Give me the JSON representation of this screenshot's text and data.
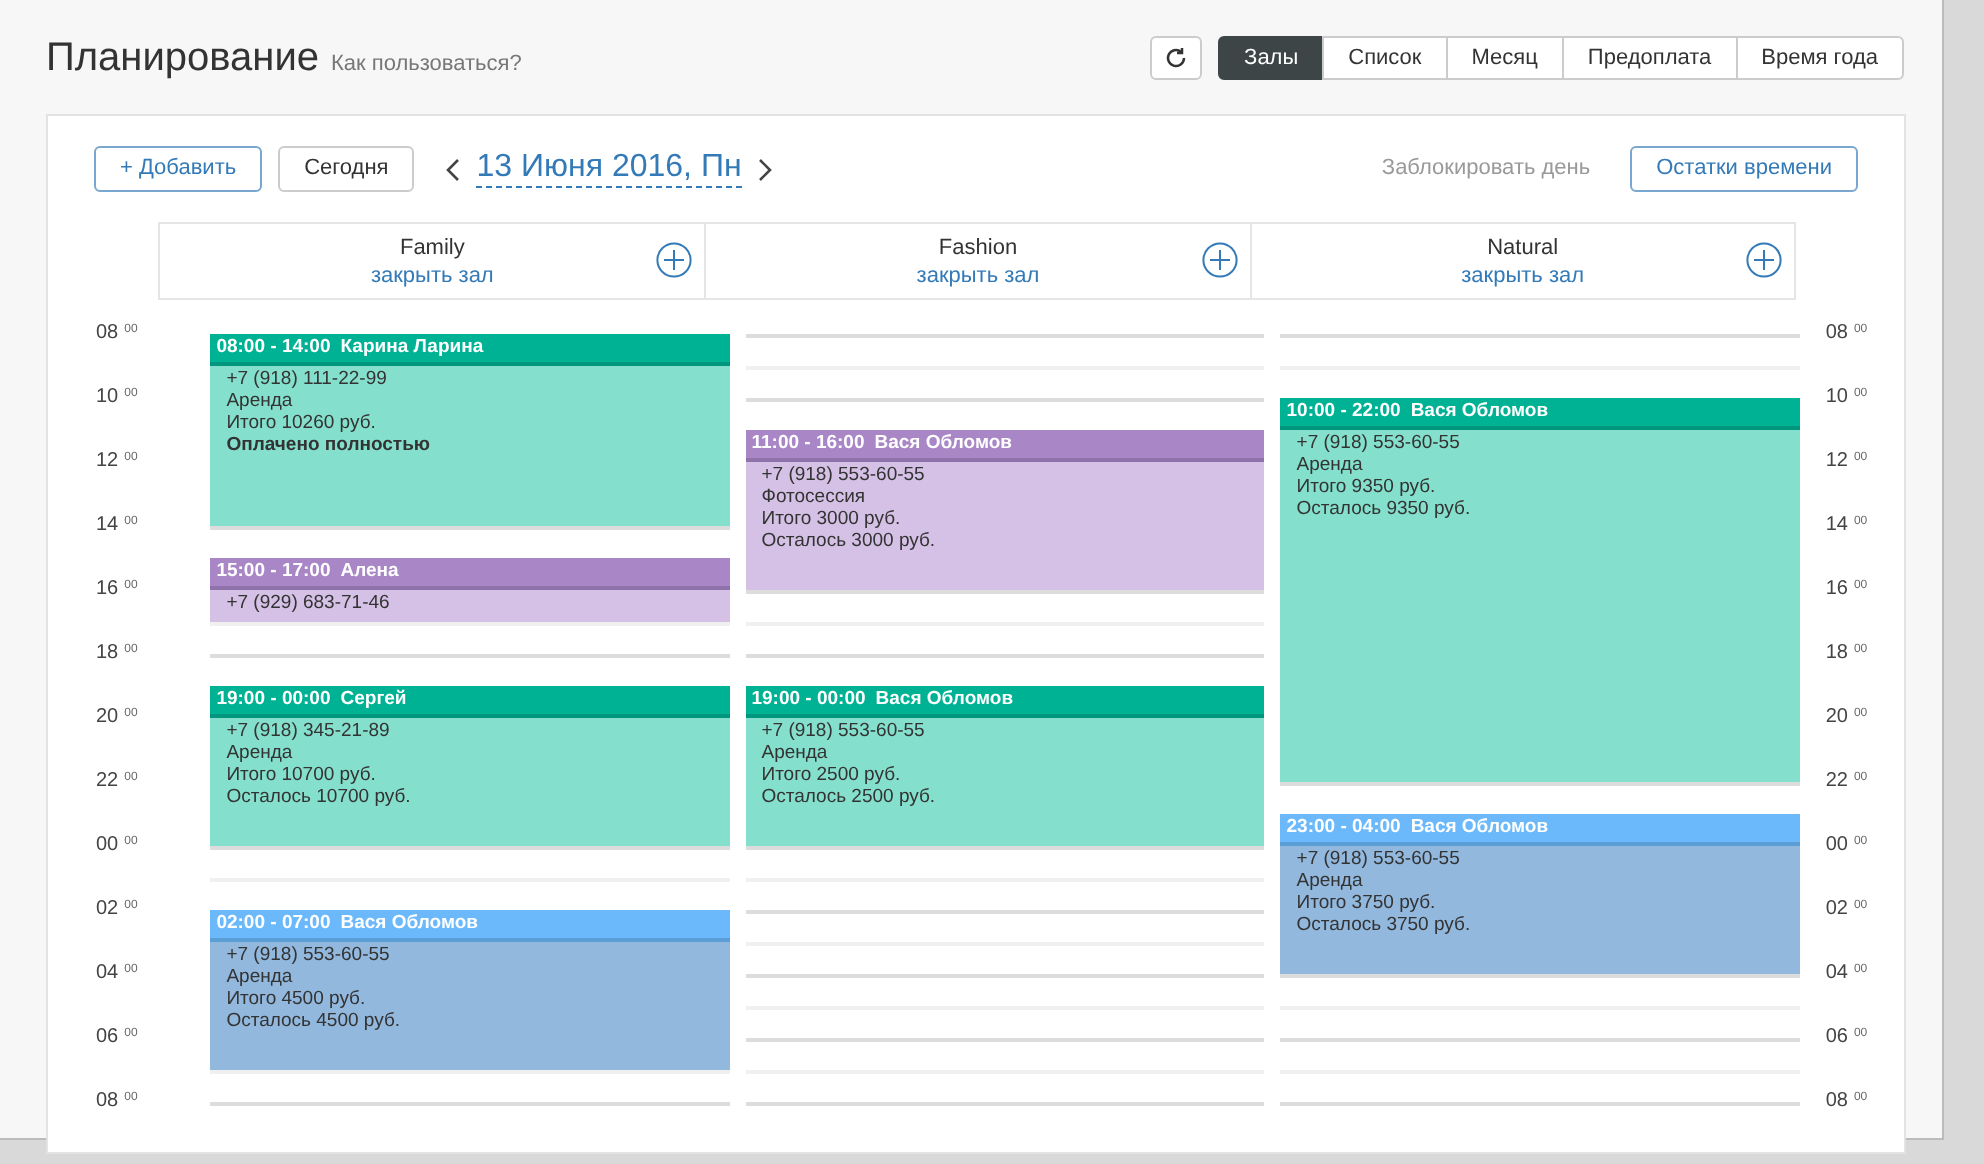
{
  "header": {
    "title": "Планирование",
    "help_link": "Как пользоваться?"
  },
  "view_tabs": [
    {
      "label": "Залы",
      "selected": true
    },
    {
      "label": "Список",
      "selected": false
    },
    {
      "label": "Месяц",
      "selected": false
    },
    {
      "label": "Предоплата",
      "selected": false
    },
    {
      "label": "Время года",
      "selected": false
    }
  ],
  "toolbar": {
    "add_button": "+ Добавить",
    "today_button": "Сегодня",
    "date": "13 Июня 2016, Пн",
    "block_day": "Заблокировать день",
    "time_left_button": "Остатки времени"
  },
  "left_time_labels": [
    {
      "hour": "08",
      "minutes": "00"
    },
    {
      "hour": "10",
      "minutes": "00"
    },
    {
      "hour": "12",
      "minutes": "00"
    },
    {
      "hour": "14",
      "minutes": "00"
    },
    {
      "hour": "16",
      "minutes": "00"
    },
    {
      "hour": "18",
      "minutes": "00"
    },
    {
      "hour": "20",
      "minutes": "00"
    },
    {
      "hour": "22",
      "minutes": "00"
    },
    {
      "hour": "00",
      "minutes": "00"
    },
    {
      "hour": "02",
      "minutes": "00"
    },
    {
      "hour": "04",
      "minutes": "00"
    },
    {
      "hour": "06",
      "minutes": "00"
    },
    {
      "hour": "08",
      "minutes": "00"
    }
  ],
  "right_time_labels": [
    {
      "hour": "08",
      "minutes": "00"
    },
    {
      "hour": "10",
      "minutes": "00"
    },
    {
      "hour": "12",
      "minutes": "00"
    },
    {
      "hour": "14",
      "minutes": "00"
    },
    {
      "hour": "16",
      "minutes": "00"
    },
    {
      "hour": "18",
      "minutes": "00"
    },
    {
      "hour": "20",
      "minutes": "00"
    },
    {
      "hour": "22",
      "minutes": "00"
    },
    {
      "hour": "00",
      "minutes": "00"
    },
    {
      "hour": "02",
      "minutes": "00"
    },
    {
      "hour": "04",
      "minutes": "00"
    },
    {
      "hour": "06",
      "minutes": "00"
    },
    {
      "hour": "08",
      "minutes": "00"
    }
  ],
  "halls": [
    {
      "name": "Family",
      "action": "закрыть зал",
      "events": [
        {
          "time": "08:00 - 14:00",
          "client": "Карина Ларина",
          "color": "#00b294",
          "lines": [
            {
              "text": "+7 (918) 111-22-99",
              "bold": false
            },
            {
              "text": "Аренда",
              "bold": false
            },
            {
              "text": "Итого 10260 руб.",
              "bold": false
            },
            {
              "text": "Оплачено полностью",
              "bold": true
            }
          ]
        },
        {
          "time": "15:00 - 17:00",
          "client": "Алена",
          "color": "#a987c7",
          "lines": [
            {
              "text": "+7 (929) 683-71-46",
              "bold": false
            }
          ]
        },
        {
          "time": "19:00 - 00:00",
          "client": "Сергей",
          "color": "#00b294",
          "lines": [
            {
              "text": "+7 (918) 345-21-89",
              "bold": false
            },
            {
              "text": "Аренда",
              "bold": false
            },
            {
              "text": "Итого 10700 руб.",
              "bold": false
            },
            {
              "text": "Осталось 10700 руб.",
              "bold": false
            }
          ]
        },
        {
          "time": "02:00 - 07:00",
          "client": "Вася Обломов",
          "color": "#6bb9fb",
          "lines": [
            {
              "text": "+7 (918) 553-60-55",
              "bold": false
            },
            {
              "text": "Аренда",
              "bold": false
            },
            {
              "text": "Итого 4500 руб.",
              "bold": false
            },
            {
              "text": "Осталось 4500 руб.",
              "bold": false
            }
          ]
        }
      ]
    },
    {
      "name": "Fashion",
      "action": "закрыть зал",
      "events": [
        {
          "time": "11:00 - 16:00",
          "client": "Вася Обломов",
          "color": "#a987c7",
          "lines": [
            {
              "text": "+7 (918) 553-60-55",
              "bold": false
            },
            {
              "text": "Фотосессия",
              "bold": false
            },
            {
              "text": "Итого 3000 руб.",
              "bold": false
            },
            {
              "text": "Осталось 3000 руб.",
              "bold": false
            }
          ]
        },
        {
          "time": "19:00 - 00:00",
          "client": "Вася Обломов",
          "color": "#00b294",
          "lines": [
            {
              "text": "+7 (918) 553-60-55",
              "bold": false
            },
            {
              "text": "Аренда",
              "bold": false
            },
            {
              "text": "Итого 2500 руб.",
              "bold": false
            },
            {
              "text": "Осталось 2500 руб.",
              "bold": false
            }
          ]
        }
      ]
    },
    {
      "name": "Natural",
      "action": "закрыть зал",
      "events": [
        {
          "time": "10:00 - 22:00",
          "client": "Вася Обломов",
          "color": "#00b294",
          "lines": [
            {
              "text": "+7 (918) 553-60-55",
              "bold": false
            },
            {
              "text": "Аренда",
              "bold": false
            },
            {
              "text": "Итого 9350 руб.",
              "bold": false
            },
            {
              "text": "Осталось 9350 руб.",
              "bold": false
            }
          ]
        },
        {
          "time": "23:00 - 04:00",
          "client": "Вася Обломов",
          "color": "#6bb9fb",
          "lines": [
            {
              "text": "+7 (918) 553-60-55",
              "bold": false
            },
            {
              "text": "Аренда",
              "bold": false
            },
            {
              "text": "Итого 3750 руб.",
              "bold": false
            },
            {
              "text": "Осталось 3750 руб.",
              "bold": false
            }
          ]
        }
      ]
    }
  ]
}
